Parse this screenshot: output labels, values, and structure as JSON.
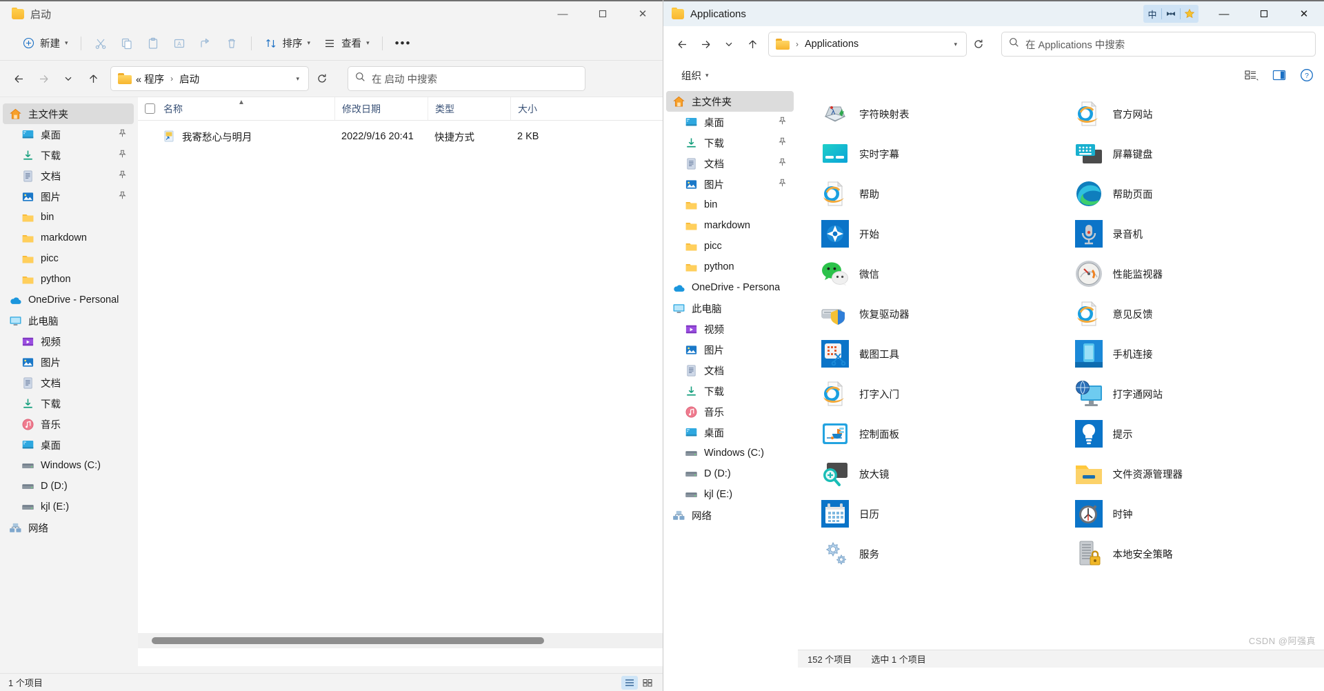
{
  "left_window": {
    "title": "启动",
    "title_icon": "folder-icon",
    "window_controls": {
      "minimize": "—",
      "maximize": "☐",
      "close": "✕"
    },
    "toolbar": {
      "new_label": "新建",
      "cut_label": "剪切",
      "copy_label": "复制",
      "paste_label": "粘贴",
      "rename_label": "重命名",
      "share_label": "共享",
      "delete_label": "删除",
      "sort_label": "排序",
      "view_label": "查看",
      "more_label": "•••"
    },
    "address": {
      "back": "back-arrow-icon",
      "forward": "forward-arrow-icon",
      "recent": "chevron-down-icon",
      "up": "up-arrow-icon",
      "crumbs": [
        "« 程序",
        "启动"
      ],
      "refresh": "refresh-icon"
    },
    "search": {
      "placeholder": "在 启动 中搜索"
    },
    "nav_items": [
      {
        "label": "主文件夹",
        "icon": "home-icon",
        "selected": true,
        "pinned": false,
        "indent": 0
      },
      {
        "label": "桌面",
        "icon": "desktop-icon",
        "selected": false,
        "pinned": true,
        "indent": 1
      },
      {
        "label": "下载",
        "icon": "downloads-icon",
        "selected": false,
        "pinned": true,
        "indent": 1
      },
      {
        "label": "文档",
        "icon": "documents-icon",
        "selected": false,
        "pinned": true,
        "indent": 1
      },
      {
        "label": "图片",
        "icon": "pictures-icon",
        "selected": false,
        "pinned": true,
        "indent": 1
      },
      {
        "label": "bin",
        "icon": "folder-icon",
        "selected": false,
        "pinned": false,
        "indent": 1
      },
      {
        "label": "markdown",
        "icon": "folder-icon",
        "selected": false,
        "pinned": false,
        "indent": 1
      },
      {
        "label": "picc",
        "icon": "folder-icon",
        "selected": false,
        "pinned": false,
        "indent": 1
      },
      {
        "label": "python",
        "icon": "folder-icon",
        "selected": false,
        "pinned": false,
        "indent": 1
      },
      {
        "label": "OneDrive - Personal",
        "icon": "onedrive-icon",
        "selected": false,
        "pinned": false,
        "indent": 0
      },
      {
        "label": "此电脑",
        "icon": "this-pc-icon",
        "selected": false,
        "pinned": false,
        "indent": 0
      },
      {
        "label": "视频",
        "icon": "videos-icon",
        "selected": false,
        "pinned": false,
        "indent": 1
      },
      {
        "label": "图片",
        "icon": "pictures-icon",
        "selected": false,
        "pinned": false,
        "indent": 1
      },
      {
        "label": "文档",
        "icon": "documents-icon",
        "selected": false,
        "pinned": false,
        "indent": 1
      },
      {
        "label": "下载",
        "icon": "downloads-icon",
        "selected": false,
        "pinned": false,
        "indent": 1
      },
      {
        "label": "音乐",
        "icon": "music-icon",
        "selected": false,
        "pinned": false,
        "indent": 1
      },
      {
        "label": "桌面",
        "icon": "desktop-icon",
        "selected": false,
        "pinned": false,
        "indent": 1
      },
      {
        "label": "Windows (C:)",
        "icon": "drive-icon",
        "selected": false,
        "pinned": false,
        "indent": 1
      },
      {
        "label": "D (D:)",
        "icon": "drive-icon",
        "selected": false,
        "pinned": false,
        "indent": 1
      },
      {
        "label": "kjl (E:)",
        "icon": "drive-icon",
        "selected": false,
        "pinned": false,
        "indent": 1
      },
      {
        "label": "网络",
        "icon": "network-icon",
        "selected": false,
        "pinned": false,
        "indent": 0
      }
    ],
    "columns": [
      "名称",
      "修改日期",
      "类型",
      "大小"
    ],
    "rows": [
      {
        "name": "我寄愁心与明月",
        "date": "2022/9/16 20:41",
        "type": "快捷方式",
        "size": "2 KB",
        "icon": "shortcut-icon"
      }
    ],
    "status": {
      "count": "1 个项目"
    }
  },
  "right_window": {
    "title": "Applications",
    "title_icon": "folder-icon",
    "ime": {
      "mode": "中",
      "tool": "bowtie-icon",
      "star": "star-icon"
    },
    "window_controls": {
      "minimize": "—",
      "maximize": "☐",
      "close": "✕"
    },
    "address": {
      "crumbs": [
        "Applications"
      ],
      "refresh": "refresh-icon"
    },
    "search": {
      "placeholder": "在 Applications 中搜索"
    },
    "command_bar": {
      "organize_label": "组织",
      "layout_label": "layout-icon",
      "preview_label": "preview-pane-icon",
      "help_label": "?"
    },
    "nav_items": [
      {
        "label": "主文件夹",
        "icon": "home-icon",
        "selected": true,
        "pinned": false,
        "indent": 0
      },
      {
        "label": "桌面",
        "icon": "desktop-icon",
        "selected": false,
        "pinned": true,
        "indent": 1
      },
      {
        "label": "下载",
        "icon": "downloads-icon",
        "selected": false,
        "pinned": true,
        "indent": 1
      },
      {
        "label": "文档",
        "icon": "documents-icon",
        "selected": false,
        "pinned": true,
        "indent": 1
      },
      {
        "label": "图片",
        "icon": "pictures-icon",
        "selected": false,
        "pinned": true,
        "indent": 1
      },
      {
        "label": "bin",
        "icon": "folder-icon",
        "selected": false,
        "pinned": false,
        "indent": 1
      },
      {
        "label": "markdown",
        "icon": "folder-icon",
        "selected": false,
        "pinned": false,
        "indent": 1
      },
      {
        "label": "picc",
        "icon": "folder-icon",
        "selected": false,
        "pinned": false,
        "indent": 1
      },
      {
        "label": "python",
        "icon": "folder-icon",
        "selected": false,
        "pinned": false,
        "indent": 1
      },
      {
        "label": "OneDrive - Persona",
        "icon": "onedrive-icon",
        "selected": false,
        "pinned": false,
        "indent": 0
      },
      {
        "label": "此电脑",
        "icon": "this-pc-icon",
        "selected": false,
        "pinned": false,
        "indent": 0
      },
      {
        "label": "视频",
        "icon": "videos-icon",
        "selected": false,
        "pinned": false,
        "indent": 1
      },
      {
        "label": "图片",
        "icon": "pictures-icon",
        "selected": false,
        "pinned": false,
        "indent": 1
      },
      {
        "label": "文档",
        "icon": "documents-icon",
        "selected": false,
        "pinned": false,
        "indent": 1
      },
      {
        "label": "下载",
        "icon": "downloads-icon",
        "selected": false,
        "pinned": false,
        "indent": 1
      },
      {
        "label": "音乐",
        "icon": "music-icon",
        "selected": false,
        "pinned": false,
        "indent": 1
      },
      {
        "label": "桌面",
        "icon": "desktop-icon",
        "selected": false,
        "pinned": false,
        "indent": 1
      },
      {
        "label": "Windows (C:)",
        "icon": "drive-icon",
        "selected": false,
        "pinned": false,
        "indent": 1
      },
      {
        "label": "D (D:)",
        "icon": "drive-icon",
        "selected": false,
        "pinned": false,
        "indent": 1
      },
      {
        "label": "kjl (E:)",
        "icon": "drive-icon",
        "selected": false,
        "pinned": false,
        "indent": 1
      },
      {
        "label": "网络",
        "icon": "network-icon",
        "selected": false,
        "pinned": false,
        "indent": 0
      }
    ],
    "apps": [
      {
        "label": "字符映射表",
        "icon": "charmap-icon"
      },
      {
        "label": "官方网站",
        "icon": "ie-document-icon"
      },
      {
        "label": "实时字幕",
        "icon": "live-captions-icon"
      },
      {
        "label": "屏幕键盘",
        "icon": "on-screen-keyboard-icon"
      },
      {
        "label": "帮助",
        "icon": "ie-document-icon"
      },
      {
        "label": "帮助页面",
        "icon": "edge-icon"
      },
      {
        "label": "开始",
        "icon": "get-started-icon"
      },
      {
        "label": "录音机",
        "icon": "sound-recorder-icon"
      },
      {
        "label": "微信",
        "icon": "wechat-icon"
      },
      {
        "label": "性能监视器",
        "icon": "performance-monitor-icon"
      },
      {
        "label": "恢复驱动器",
        "icon": "recovery-drive-icon"
      },
      {
        "label": "意见反馈",
        "icon": "ie-document-icon"
      },
      {
        "label": "截图工具",
        "icon": "snipping-tool-icon"
      },
      {
        "label": "手机连接",
        "icon": "phone-link-icon"
      },
      {
        "label": "打字入门",
        "icon": "ie-document-icon"
      },
      {
        "label": "打字通网站",
        "icon": "web-monitor-icon"
      },
      {
        "label": "控制面板",
        "icon": "control-panel-icon"
      },
      {
        "label": "提示",
        "icon": "tips-icon"
      },
      {
        "label": "放大镜",
        "icon": "magnifier-icon"
      },
      {
        "label": "文件资源管理器",
        "icon": "file-explorer-icon"
      },
      {
        "label": "日历",
        "icon": "calendar-icon"
      },
      {
        "label": "时钟",
        "icon": "clock-icon"
      },
      {
        "label": "服务",
        "icon": "services-icon"
      },
      {
        "label": "本地安全策略",
        "icon": "local-security-policy-icon"
      }
    ],
    "status": {
      "count": "152 个项目",
      "selected": "选中 1 个项目"
    },
    "watermark": "CSDN @阿强真"
  }
}
